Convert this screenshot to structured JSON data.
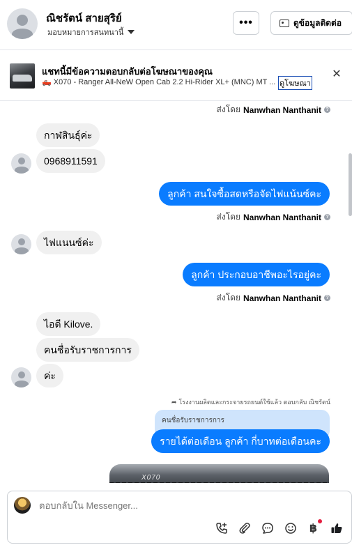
{
  "header": {
    "contact_name": "ณิชรัตน์ สายสุริย์",
    "assign_label": "มอบหมายการสนทนานี้",
    "more_label": "•••",
    "contact_info_label": "ดูข้อมูลติดต่อ"
  },
  "ad_banner": {
    "title": "แชทนี้มีข้อความตอบกลับต่อโฆษณาของคุณ",
    "subtitle": "🛻 X070 - Ranger All-NeW Open Cab 2.2 Hi-Rider XL+ (MNC) MT ...",
    "view_ad_label": "ดูโฆษณา",
    "close_label": "✕"
  },
  "messages": {
    "sent_by_prefix": "ส่งโดย",
    "sender_name": "Nanwhan Nanthanit",
    "in_1": "กาฬสินธุ์ค่ะ",
    "in_2": "0968911591",
    "out_1": "ลูกค้า สนใจซื้อสดหรือจัดไฟแน้นซ์คะ",
    "in_3": "ไฟแนนซ์ค่ะ",
    "out_2": "ลูกค้า ประกอบอาชีพอะไรอยู่คะ",
    "in_4": "ไอดี Kilove.",
    "in_5": "คนชื่อรับราชการการ",
    "in_6": "ค่ะ",
    "reply_note": "โรงงานผลิตและกระจายรถยนต์ใช้แล้ว ตอบกลับ ณิชรัตน์",
    "quoted_text": "คนชื่อรับราชการการ",
    "out_3": "รายได้ต่อเดือน ลูกค้า กี่บาทต่อเดือนคะ",
    "photo_plate": "X070"
  },
  "composer": {
    "placeholder": "ตอบกลับใน Messenger..."
  },
  "colors": {
    "outgoing_bubble": "#0a7cff",
    "incoming_bubble": "#f0f0f0",
    "quote_bg": "#cfe4fc"
  }
}
